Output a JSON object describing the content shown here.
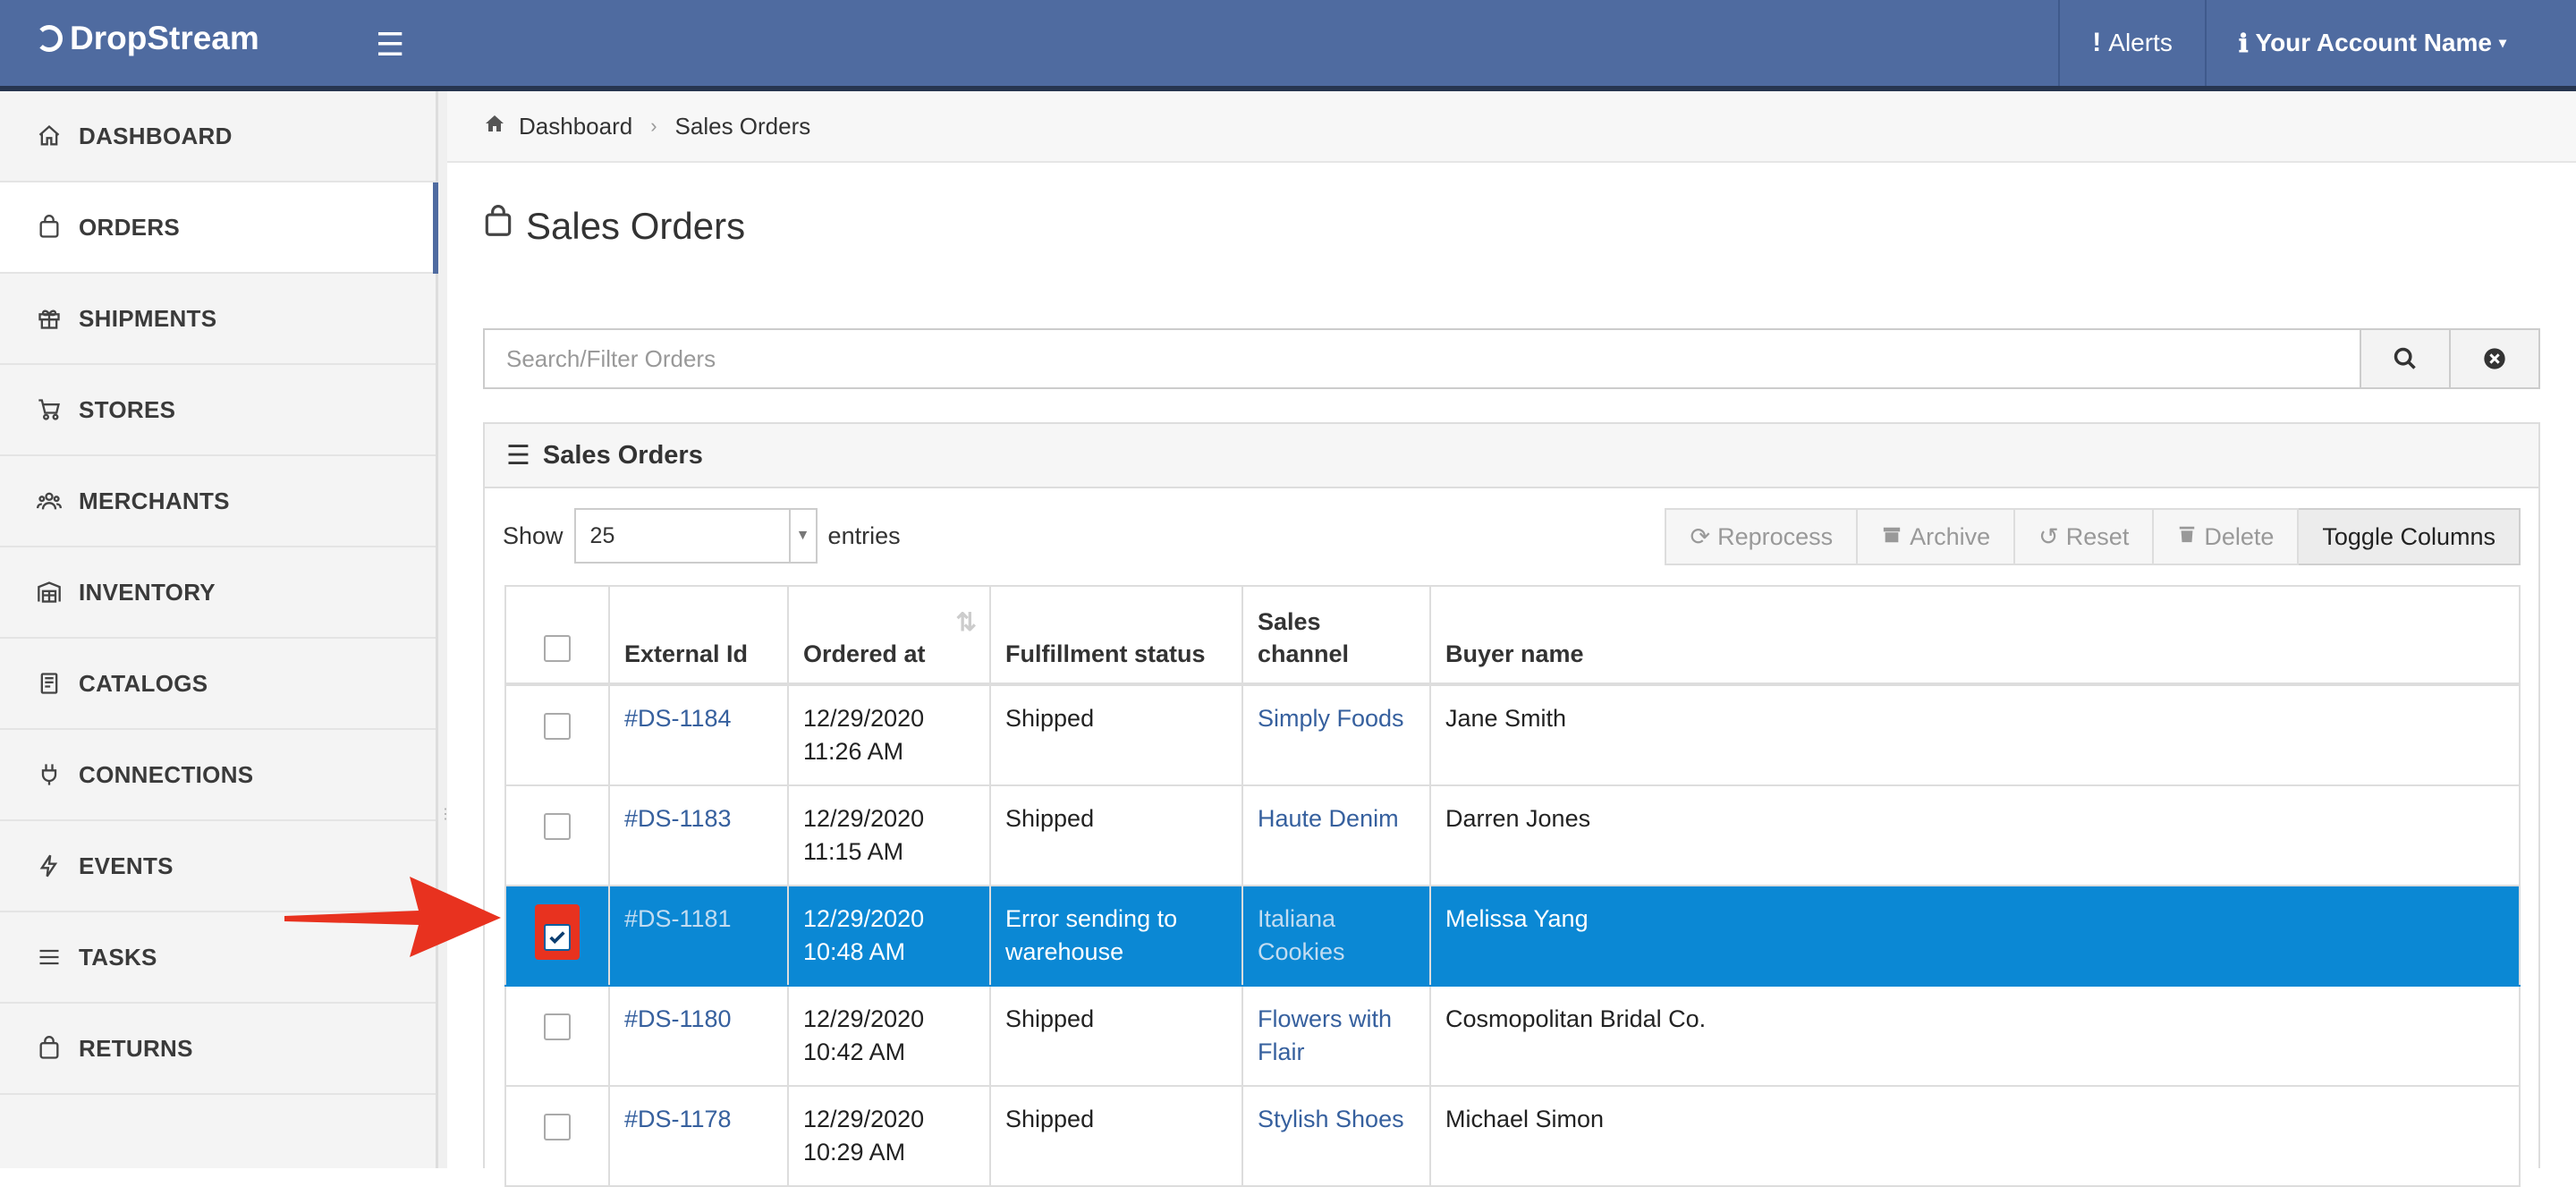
{
  "app": {
    "logo": "DropStream"
  },
  "topbar": {
    "alerts_label": "Alerts",
    "account_label": "Your Account Name"
  },
  "sidebar": {
    "items": [
      {
        "label": "DASHBOARD",
        "icon": "home-icon"
      },
      {
        "label": "ORDERS",
        "icon": "shopping-bag-icon"
      },
      {
        "label": "SHIPMENTS",
        "icon": "gift-icon"
      },
      {
        "label": "STORES",
        "icon": "cart-icon"
      },
      {
        "label": "MERCHANTS",
        "icon": "users-icon"
      },
      {
        "label": "INVENTORY",
        "icon": "warehouse-icon"
      },
      {
        "label": "CATALOGS",
        "icon": "book-icon"
      },
      {
        "label": "CONNECTIONS",
        "icon": "plug-icon"
      },
      {
        "label": "EVENTS",
        "icon": "bolt-icon"
      },
      {
        "label": "TASKS",
        "icon": "list-icon"
      },
      {
        "label": "RETURNS",
        "icon": "bag-return-icon"
      }
    ],
    "active": "ORDERS"
  },
  "breadcrumb": {
    "home": "Dashboard",
    "current": "Sales Orders"
  },
  "page": {
    "title": "Sales Orders"
  },
  "search": {
    "placeholder": "Search/Filter Orders"
  },
  "panel": {
    "title": "Sales Orders",
    "show_label": "Show",
    "entries_value": "25",
    "entries_label": "entries",
    "actions": {
      "reprocess": "Reprocess",
      "archive": "Archive",
      "reset": "Reset",
      "delete": "Delete",
      "toggle": "Toggle Columns"
    }
  },
  "table": {
    "headers": {
      "external_id": "External Id",
      "ordered_at": "Ordered at",
      "fulfillment": "Fulfillment status",
      "channel": "Sales channel",
      "buyer": "Buyer name"
    },
    "rows": [
      {
        "id": "#DS-1184",
        "ordered_at": "12/29/2020 11:26 AM",
        "status": "Shipped",
        "channel": "Simply Foods",
        "buyer": "Jane Smith",
        "checked": false
      },
      {
        "id": "#DS-1183",
        "ordered_at": "12/29/2020 11:15 AM",
        "status": "Shipped",
        "channel": "Haute Denim",
        "buyer": "Darren Jones",
        "checked": false
      },
      {
        "id": "#DS-1181",
        "ordered_at": "12/29/2020 10:48 AM",
        "status": "Error sending to warehouse",
        "channel": "Italiana Cookies",
        "buyer": "Melissa Yang",
        "checked": true
      },
      {
        "id": "#DS-1180",
        "ordered_at": "12/29/2020 10:42 AM",
        "status": "Shipped",
        "channel": "Flowers with Flair",
        "buyer": "Cosmopolitan Bridal Co.",
        "checked": false
      },
      {
        "id": "#DS-1178",
        "ordered_at": "12/29/2020 10:29 AM",
        "status": "Shipped",
        "channel": "Stylish Shoes",
        "buyer": "Michael Simon",
        "checked": false
      }
    ]
  },
  "colors": {
    "topbar": "#4f6ba0",
    "selected_row": "#0b88d4",
    "annotation": "#e8321f",
    "link": "#36609e"
  }
}
